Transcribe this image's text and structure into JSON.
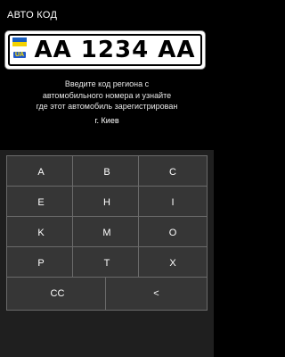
{
  "app": {
    "title": "АВТО КОД"
  },
  "plate": {
    "country_code": "UA",
    "number": "AA 1234 AA",
    "flag_colors": {
      "top": "#1b5fbf",
      "bottom": "#f3d200"
    }
  },
  "instruction": {
    "line1": "Введите код региона с",
    "line2": "автомобильного номера и узнайте",
    "line3": "где этот автомобиль зарегистрирован"
  },
  "result": {
    "region": "г. Киев"
  },
  "keyboard": {
    "row1": [
      "A",
      "B",
      "C"
    ],
    "row2": [
      "E",
      "H",
      "I"
    ],
    "row3": [
      "K",
      "M",
      "O"
    ],
    "row4": [
      "P",
      "T",
      "X"
    ],
    "row5": [
      "CC",
      "<"
    ]
  },
  "colors": {
    "background": "#000000",
    "key_fill": "#363636",
    "key_border": "#6a6a6a",
    "keyboard_bg": "#1f1f1f"
  }
}
